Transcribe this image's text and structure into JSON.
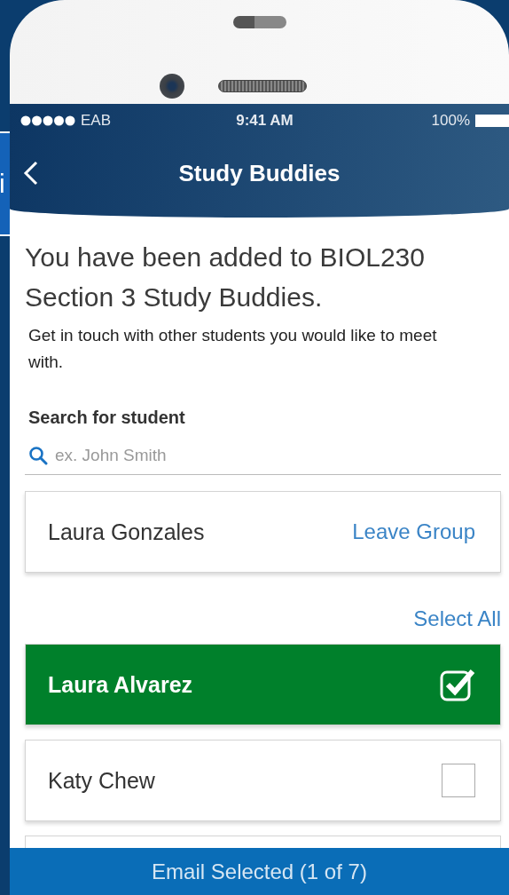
{
  "background_fragment": {
    "text": "i"
  },
  "status_bar": {
    "carrier": "EAB",
    "time": "9:41 AM",
    "battery": "100%"
  },
  "nav": {
    "title": "Study Buddies"
  },
  "message": {
    "heading": "You have been added to BIOL230 Section 3 Study Buddies.",
    "body": "Get in touch with other students you would like to meet with."
  },
  "search": {
    "label": "Search for student",
    "placeholder": "ex. John Smith"
  },
  "group_member": {
    "name": "Laura Gonzales",
    "action": "Leave Group"
  },
  "select_all": "Select All",
  "students": [
    {
      "name": "Laura Alvarez",
      "checked": true
    },
    {
      "name": "Katy Chew",
      "checked": false
    }
  ],
  "email_button": "Email Selected (1 of 7)"
}
